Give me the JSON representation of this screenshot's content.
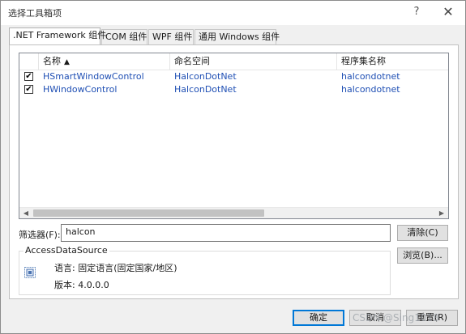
{
  "window": {
    "title": "选择工具箱项",
    "help_glyph": "?",
    "close_glyph": "✕"
  },
  "tabs": [
    {
      "label": ".NET Framework 组件",
      "active": true
    },
    {
      "label": "COM 组件",
      "active": false
    },
    {
      "label": "WPF 组件",
      "active": false
    },
    {
      "label": "通用 Windows 组件",
      "active": false
    }
  ],
  "list": {
    "columns": {
      "name": "名称",
      "namespace": "命名空间",
      "assembly": "程序集名称"
    },
    "sort_glyph": "▲",
    "rows": [
      {
        "checked": true,
        "name": "HSmartWindowControl",
        "namespace": "HalconDotNet",
        "assembly": "halcondotnet"
      },
      {
        "checked": true,
        "name": "HWindowControl",
        "namespace": "HalconDotNet",
        "assembly": "halcondotnet"
      }
    ],
    "scroll_left_glyph": "◀",
    "scroll_right_glyph": "▶"
  },
  "filter": {
    "label": "筛选器(F):",
    "value": "halcon"
  },
  "buttons": {
    "clear": "清除(C)",
    "browse": "浏览(B)...",
    "ok": "确定",
    "cancel": "取消",
    "reset": "重置(R)"
  },
  "details": {
    "group_title": "AccessDataSource",
    "language": "语言: 固定语言(固定国家/地区)",
    "version": "版本: 4.0.0.0"
  },
  "watermark": "CSDN @Sing1018",
  "icons": {
    "component": "component-icon",
    "check": "✔"
  },
  "colors": {
    "link_text": "#1f4fb4",
    "panel_bg": "#ffffff",
    "dialog_bg": "#f0f0f0",
    "accent_border": "#0078d7"
  }
}
